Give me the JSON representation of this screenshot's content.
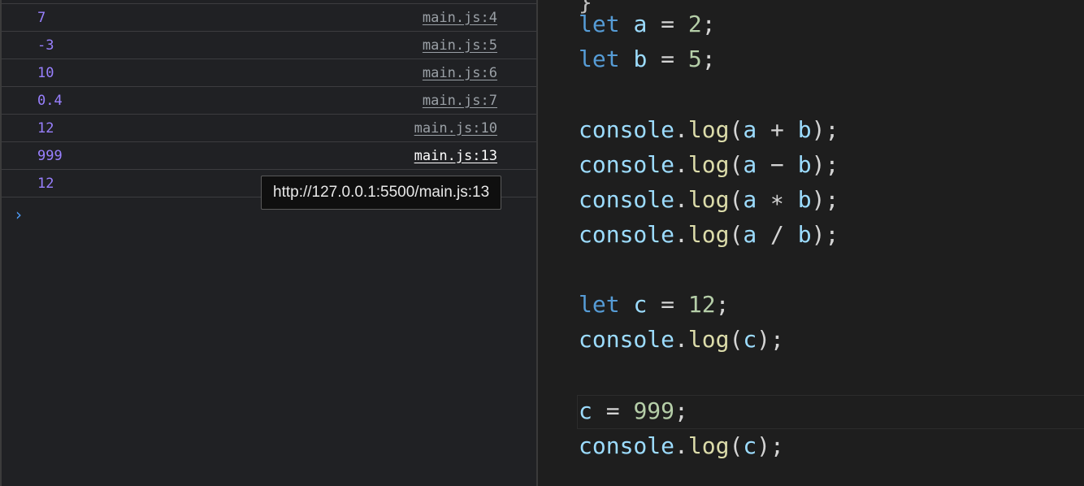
{
  "console": {
    "messages": [
      {
        "value": "7",
        "source": "main.js:4"
      },
      {
        "value": "-3",
        "source": "main.js:5"
      },
      {
        "value": "10",
        "source": "main.js:6"
      },
      {
        "value": "0.4",
        "source": "main.js:7"
      },
      {
        "value": "12",
        "source": "main.js:10"
      },
      {
        "value": "999",
        "source": "main.js:13"
      },
      {
        "value": "12",
        "source": ""
      }
    ],
    "prompt": "›",
    "tooltip": "http://127.0.0.1:5500/main.js:13"
  },
  "editor": {
    "lines": [
      [
        "let",
        "a",
        "=",
        "2",
        ";"
      ],
      [
        "let",
        "b",
        "=",
        "5",
        ";"
      ],
      [
        "console",
        ".",
        "log",
        "(",
        "a",
        "+",
        "b",
        ")",
        ";"
      ],
      [
        "console",
        ".",
        "log",
        "(",
        "a",
        "−",
        "b",
        ")",
        ";"
      ],
      [
        "console",
        ".",
        "log",
        "(",
        "a",
        "∗",
        "b",
        ")",
        ";"
      ],
      [
        "console",
        ".",
        "log",
        "(",
        "a",
        "/",
        "b",
        ")",
        ";"
      ],
      [
        "let",
        "c",
        "=",
        "12",
        ";"
      ],
      [
        "console",
        ".",
        "log",
        "(",
        "c",
        ")",
        ";"
      ],
      [
        "c",
        "=",
        "999",
        ";"
      ],
      [
        "console",
        ".",
        "log",
        "(",
        "c",
        ")",
        ";"
      ]
    ],
    "cut_glyph": "}"
  },
  "colors": {
    "console_bg": "#202124",
    "editor_bg": "#1e1e1e",
    "value_purple": "#9980ff",
    "keyword_blue": "#569cd6",
    "identifier_lightblue": "#9cdcfe",
    "function_yellow": "#dcdcaa",
    "number_green": "#b5cea8",
    "prompt_blue": "#4e9bf5"
  }
}
